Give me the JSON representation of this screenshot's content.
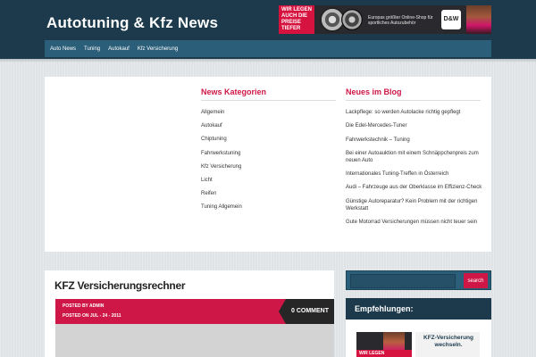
{
  "header": {
    "site_title": "Autotuning & Kfz News",
    "banner": {
      "red_text": "WIR LEGEN AUCH DIE PREISE TIEFER",
      "tagline": "Europas größter Online-Shop für sportliches Autozubehör",
      "logo": "D&W"
    }
  },
  "nav": {
    "items": [
      "Auto News",
      "Tuning",
      "Autokauf",
      "Kfz Versicherung"
    ]
  },
  "categories": {
    "heading": "News Kategorien",
    "items": [
      "Allgemein",
      "Autokauf",
      "Chiptuning",
      "Fahrwerkstuning",
      "Kfz Versicherung",
      "Licht",
      "Reifen",
      "Tuning Allgemein"
    ]
  },
  "blog": {
    "heading": "Neues im Blog",
    "items": [
      "Lackpflege: so werden Autolacke richtig gepflegt",
      "Die Edel-Mercedes-Tuner",
      "Fahrwerkstechnik – Tuning",
      "Bei einer Autoauktion mit einem Schnäppchenpreis zum neuen Auto",
      "Internationales Tuning-Treffen in Österreich",
      "Audi – Fahrzeuge aus der Oberklasse im Effizienz-Check",
      "Günstige Autoreparatur? Kein Problem mit der richtigen Werkstatt",
      "Gute Motorrad Versicherungen müssen nicht teuer sein"
    ]
  },
  "article": {
    "title": "KFZ Versicherungsrechner",
    "posted_by": "POSTED BY ADMIN",
    "posted_on": "POSTED ON JUL - 24 - 2011",
    "comments": "0 COMMENT"
  },
  "sidebar": {
    "search_value": "",
    "search_button": "search",
    "widget_heading": "Empfehlungen:",
    "ad_left_text": "WIR LEGEN",
    "ad_right_text": "KFZ-Versicherung wechseln."
  },
  "colors": {
    "header_bg": "#1c3a4c",
    "nav_bg": "#2a5e79",
    "accent": "#cf1747"
  }
}
